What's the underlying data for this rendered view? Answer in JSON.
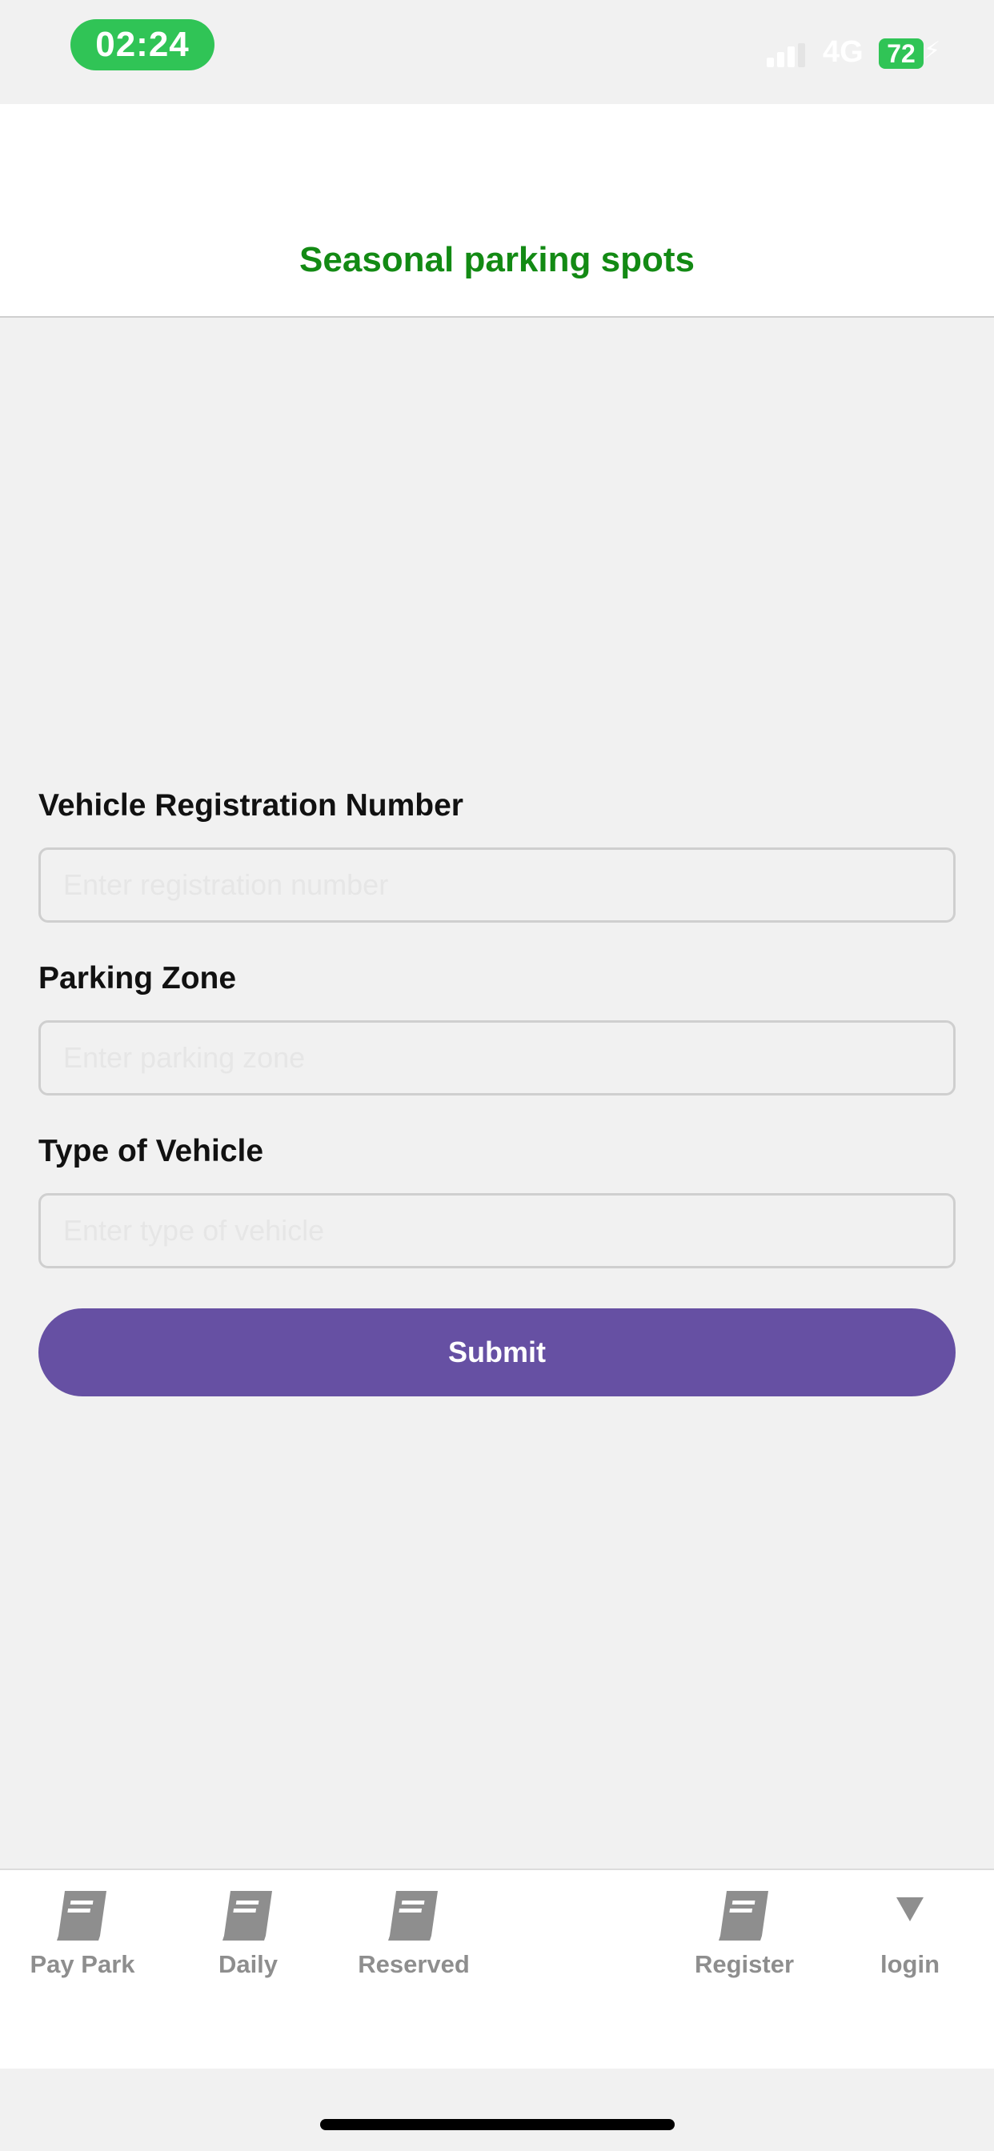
{
  "status_bar": {
    "time": "02:24",
    "network": "4G",
    "battery": "72"
  },
  "header": {
    "title": "Seasonal parking spots"
  },
  "form": {
    "registration": {
      "label": "Vehicle Registration Number",
      "placeholder": "Enter registration number",
      "value": ""
    },
    "zone": {
      "label": "Parking Zone",
      "placeholder": "Enter parking zone",
      "value": ""
    },
    "vehicle_type": {
      "label": "Type of Vehicle",
      "placeholder": "Enter type of vehicle",
      "value": ""
    },
    "submit_label": "Submit"
  },
  "tabs": [
    {
      "label": "Pay Park",
      "icon": "book-icon"
    },
    {
      "label": "Daily",
      "icon": "book-icon"
    },
    {
      "label": "Reserved",
      "icon": "book-icon"
    },
    {
      "label": "Register",
      "icon": "book-icon"
    },
    {
      "label": "login",
      "icon": "triangle-down-icon"
    }
  ],
  "colors": {
    "header_title": "#138a14",
    "submit_button": "#6650a3",
    "time_pill": "#30c456"
  }
}
